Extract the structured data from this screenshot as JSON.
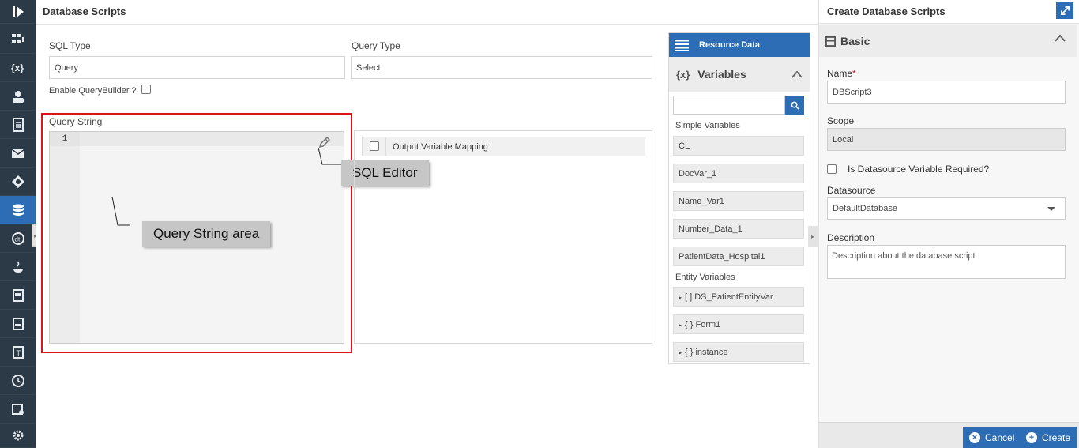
{
  "rail": {
    "icons": [
      "logo-icon",
      "process-icon",
      "variables-icon",
      "user-icon",
      "document-icon",
      "mail-icon",
      "integration-icon",
      "database-icon",
      "datetime-icon",
      "java-icon",
      "text-file-icon",
      "css-icon",
      "template-icon",
      "clock-icon",
      "config-icon",
      "settings-icon"
    ],
    "active_index": 7
  },
  "main": {
    "title": "Database Scripts",
    "sql_type_label": "SQL Type",
    "sql_type_value": "Query",
    "query_type_label": "Query Type",
    "query_type_value": "Select",
    "enable_querybuilder_label": "Enable QueryBuilder ?",
    "query_string_label": "Query String",
    "editor_line_number": "1",
    "callout_sql_editor": "SQL Editor",
    "callout_query_area": "Query String area",
    "output_mapping_label": "Output Variable Mapping"
  },
  "resource": {
    "title": "Resource Data",
    "variables_title": "Variables",
    "variables_prefix": "{x}",
    "simple_label": "Simple Variables",
    "simple_vars": [
      "CL",
      "DocVar_1",
      "Name_Var1",
      "Number_Data_1",
      "PatientData_Hospital1"
    ],
    "entity_label": "Entity Variables",
    "entity_vars": [
      "[ ] DS_PatientEntityVar",
      "{ } Form1",
      "{ } instance"
    ]
  },
  "right": {
    "title": "Create Database Scripts",
    "section": "Basic",
    "name_label": "Name",
    "name_required": "*",
    "name_value": "DBScript3",
    "scope_label": "Scope",
    "scope_value": "Local",
    "datasource_required_label": "Is Datasource Variable Required?",
    "datasource_label": "Datasource",
    "datasource_value": "DefaultDatabase",
    "description_label": "Description",
    "description_placeholder": "Description about the database script",
    "cancel_label": "Cancel",
    "create_label": "Create"
  },
  "colors": {
    "accent": "#2d6db5",
    "rail_bg": "#2b3a46",
    "highlight_outline": "#d9141b"
  }
}
